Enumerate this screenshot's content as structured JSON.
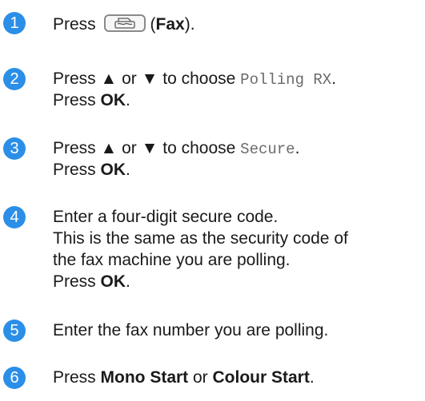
{
  "steps": [
    {
      "number": "1",
      "line1": {
        "prefix": "Press",
        "open_paren": "(",
        "bold": "Fax",
        "close": ")."
      }
    },
    {
      "number": "2",
      "line1": {
        "prefix": "Press ▲ or ▼ to choose ",
        "mono": "Polling RX",
        "suffix": "."
      },
      "line2": {
        "prefix": "Press ",
        "bold": "OK",
        "suffix": "."
      }
    },
    {
      "number": "3",
      "line1": {
        "prefix": "Press ▲ or ▼ to choose ",
        "mono": "Secure",
        "suffix": "."
      },
      "line2": {
        "prefix": "Press ",
        "bold": "OK",
        "suffix": "."
      }
    },
    {
      "number": "4",
      "line1": "Enter a four-digit secure code.",
      "line2": "This is the same as the security code of",
      "line3": "the fax machine you are polling.",
      "line4": {
        "prefix": "Press ",
        "bold": "OK",
        "suffix": "."
      }
    },
    {
      "number": "5",
      "line1": "Enter the fax number you are polling."
    },
    {
      "number": "6",
      "line1": {
        "prefix": "Press ",
        "bold1": "Mono Start",
        "mid": " or ",
        "bold2": "Colour Start",
        "suffix": "."
      }
    }
  ],
  "icons": {
    "fax_key": "fax-key-icon"
  },
  "colors": {
    "badge": "#2b8fe8",
    "text": "#1a1a1a",
    "mono": "#6b6b6b"
  }
}
